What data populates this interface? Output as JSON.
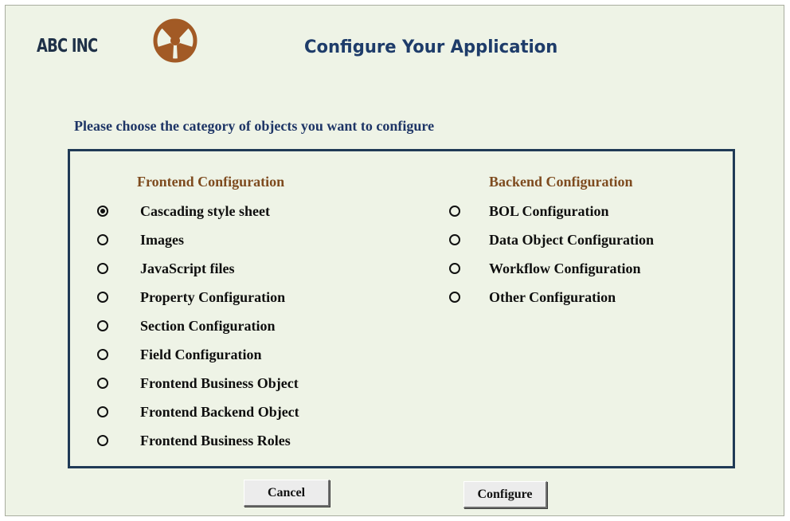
{
  "header": {
    "brand": "ABC INC",
    "title": "Configure Your Application",
    "logo_icon": "steering-wheel-icon",
    "logo_color": "#a25a25"
  },
  "instruction": "Please choose the category of objects you want to configure",
  "frontend": {
    "heading": "Frontend Configuration",
    "options": [
      {
        "label": "Cascading style sheet",
        "selected": true
      },
      {
        "label": "Images",
        "selected": false
      },
      {
        "label": "JavaScript files",
        "selected": false
      },
      {
        "label": "Property Configuration",
        "selected": false
      },
      {
        "label": "Section Configuration",
        "selected": false
      },
      {
        "label": "Field Configuration",
        "selected": false
      },
      {
        "label": "Frontend Business Object",
        "selected": false
      },
      {
        "label": "Frontend Backend Object",
        "selected": false
      },
      {
        "label": "Frontend Business Roles",
        "selected": false
      }
    ]
  },
  "backend": {
    "heading": "Backend Configuration",
    "options": [
      {
        "label": "BOL Configuration",
        "selected": false
      },
      {
        "label": "Data Object Configuration",
        "selected": false
      },
      {
        "label": "Workflow Configuration",
        "selected": false
      },
      {
        "label": "Other Configuration",
        "selected": false
      }
    ]
  },
  "buttons": {
    "cancel": "Cancel",
    "configure": "Configure"
  },
  "colors": {
    "background": "#eef3e6",
    "heading_brown": "#7e4b1f",
    "title_blue": "#1e3c6a",
    "panel_border": "#203a56"
  }
}
